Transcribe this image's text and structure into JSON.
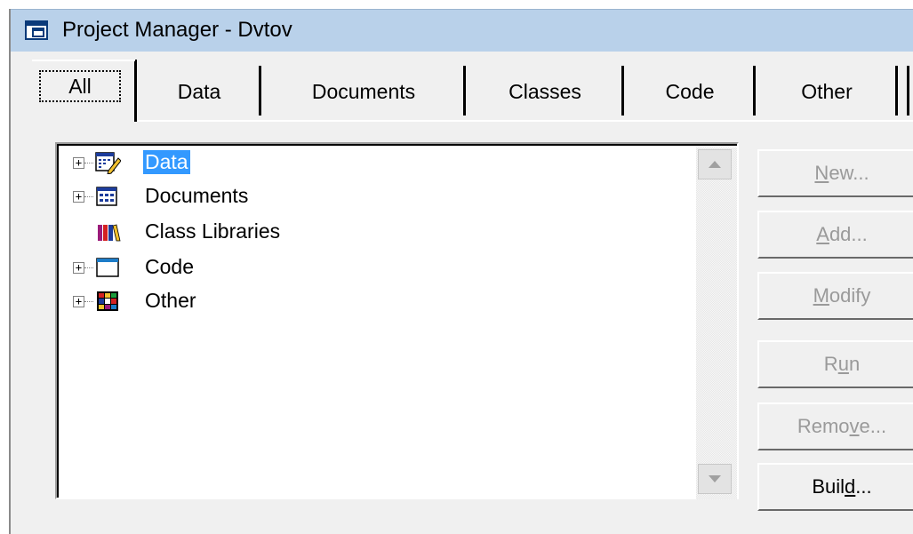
{
  "window": {
    "title": "Project Manager - Dvtov"
  },
  "tabs": [
    {
      "label": "All",
      "active": true
    },
    {
      "label": "Data"
    },
    {
      "label": "Documents"
    },
    {
      "label": "Classes"
    },
    {
      "label": "Code"
    },
    {
      "label": "Other"
    }
  ],
  "tree": {
    "items": [
      {
        "label": "Data",
        "expandable": true,
        "selected": true,
        "icon": "data-icon"
      },
      {
        "label": "Documents",
        "expandable": true,
        "icon": "documents-icon"
      },
      {
        "label": "Class Libraries",
        "expandable": false,
        "icon": "class-libraries-icon"
      },
      {
        "label": "Code",
        "expandable": true,
        "icon": "code-icon"
      },
      {
        "label": "Other",
        "expandable": true,
        "icon": "other-icon"
      }
    ]
  },
  "buttons": {
    "new": {
      "pre": "",
      "key": "N",
      "post": "ew...",
      "enabled": false
    },
    "add": {
      "pre": "",
      "key": "A",
      "post": "dd...",
      "enabled": false
    },
    "modify": {
      "pre": "",
      "key": "M",
      "post": "odify",
      "enabled": false
    },
    "run": {
      "pre": "R",
      "key": "u",
      "post": "n",
      "enabled": false
    },
    "remove": {
      "pre": "Remo",
      "key": "v",
      "post": "e...",
      "enabled": false
    },
    "build": {
      "pre": "Buil",
      "key": "d",
      "post": "...",
      "enabled": true
    }
  },
  "colors": {
    "titlebar": "#b9d1ea",
    "selection": "#3399ff",
    "disabled_text": "#9a9a9a"
  }
}
